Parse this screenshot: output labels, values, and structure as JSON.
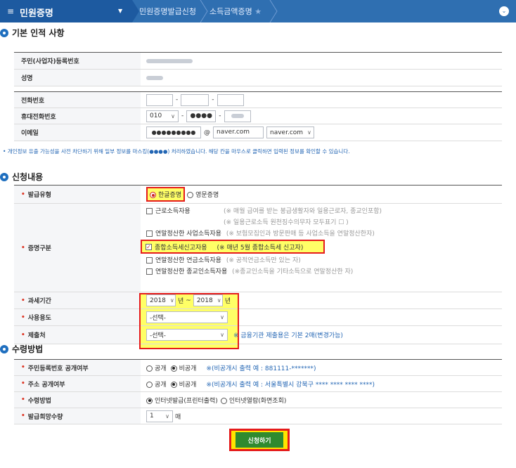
{
  "nav": {
    "menu_title": "민원증명",
    "crumb1": "민원증명발급신청",
    "crumb2": "소득금액증명"
  },
  "basic": {
    "title": "기본 인적 사항",
    "id_label": "주민(사업자)등록번호",
    "name_label": "성명",
    "phone_label": "전화번호",
    "mobile_label": "휴대전화번호",
    "mobile_prefix": "010",
    "mobile_mid": "●●●●",
    "email_label": "이메일",
    "email_masked": "●●●●●●●●●",
    "email_at": "@",
    "email_domain": "naver.com",
    "email_select": "naver.com",
    "dash": "-",
    "mask_notice": "• 개인정보 유출 가능성을 사전 차단하기 위해 일부 정보를 마스킹(●●●●) 처리하였습니다. 해당 칸을 마우스로 클릭하면 입력된 정보를 확인할 수 있습니다."
  },
  "apply": {
    "title": "신청내용",
    "issue_type_label": "발급유형",
    "issue_korean": "한글증명",
    "issue_english": "영문증명",
    "cert_type_label": "증명구분",
    "cert_options": [
      {
        "label": "근로소득자용",
        "note": "(※ 매월 급여를 받는 봉급생활자와 일용근로자, 종교인포함)"
      },
      {
        "label": "",
        "note": "(※ 일용근로소득 원천징수의무자 모두표기 ☐ )"
      },
      {
        "label": "연말정산한 사업소득자용",
        "note": "(※ 보험모집인과 방문판매 등 사업소득을 연말정산한자)"
      },
      {
        "label": "종합소득세신고자용",
        "note": "(※ 매년 5월 종합소득세 신고자)"
      },
      {
        "label": "연말정산한 연금소득자용",
        "note": "(※ 공적연금소득만 있는 자)"
      },
      {
        "label": "연말정산한 종교인소득자용",
        "note": "(※종교인소득을 기타소득으로 연말정산한 자)"
      }
    ],
    "period_label": "과세기간",
    "year_from": "2018",
    "year_to": "2018",
    "year_unit": "년",
    "tilde": "~",
    "usage_label": "사용용도",
    "usage_select": "-선택-",
    "submit_to_label": "제출처",
    "submit_to_select": "-선택-",
    "submit_note": "※ 금융기관 제출용은 기본 2매(변경가능)"
  },
  "receive": {
    "title": "수령방법",
    "rrn_public_label": "주민등록번호 공개여부",
    "addr_public_label": "주소 공개여부",
    "public": "공개",
    "private": "비공개",
    "rrn_note": "※(비공개시 출력 예 : 881111-*******)",
    "addr_note": "※(비공개시 출력 예 : 서울특별시 강북구 **** **** **** ****)",
    "method_label": "수령방법",
    "method_print": "인터넷발급(프린터출력)",
    "method_view": "인터넷열람(화면조회)",
    "qty_label": "발급희망수량",
    "qty_value": "1",
    "qty_unit": "매"
  },
  "submit_button": "신청하기"
}
